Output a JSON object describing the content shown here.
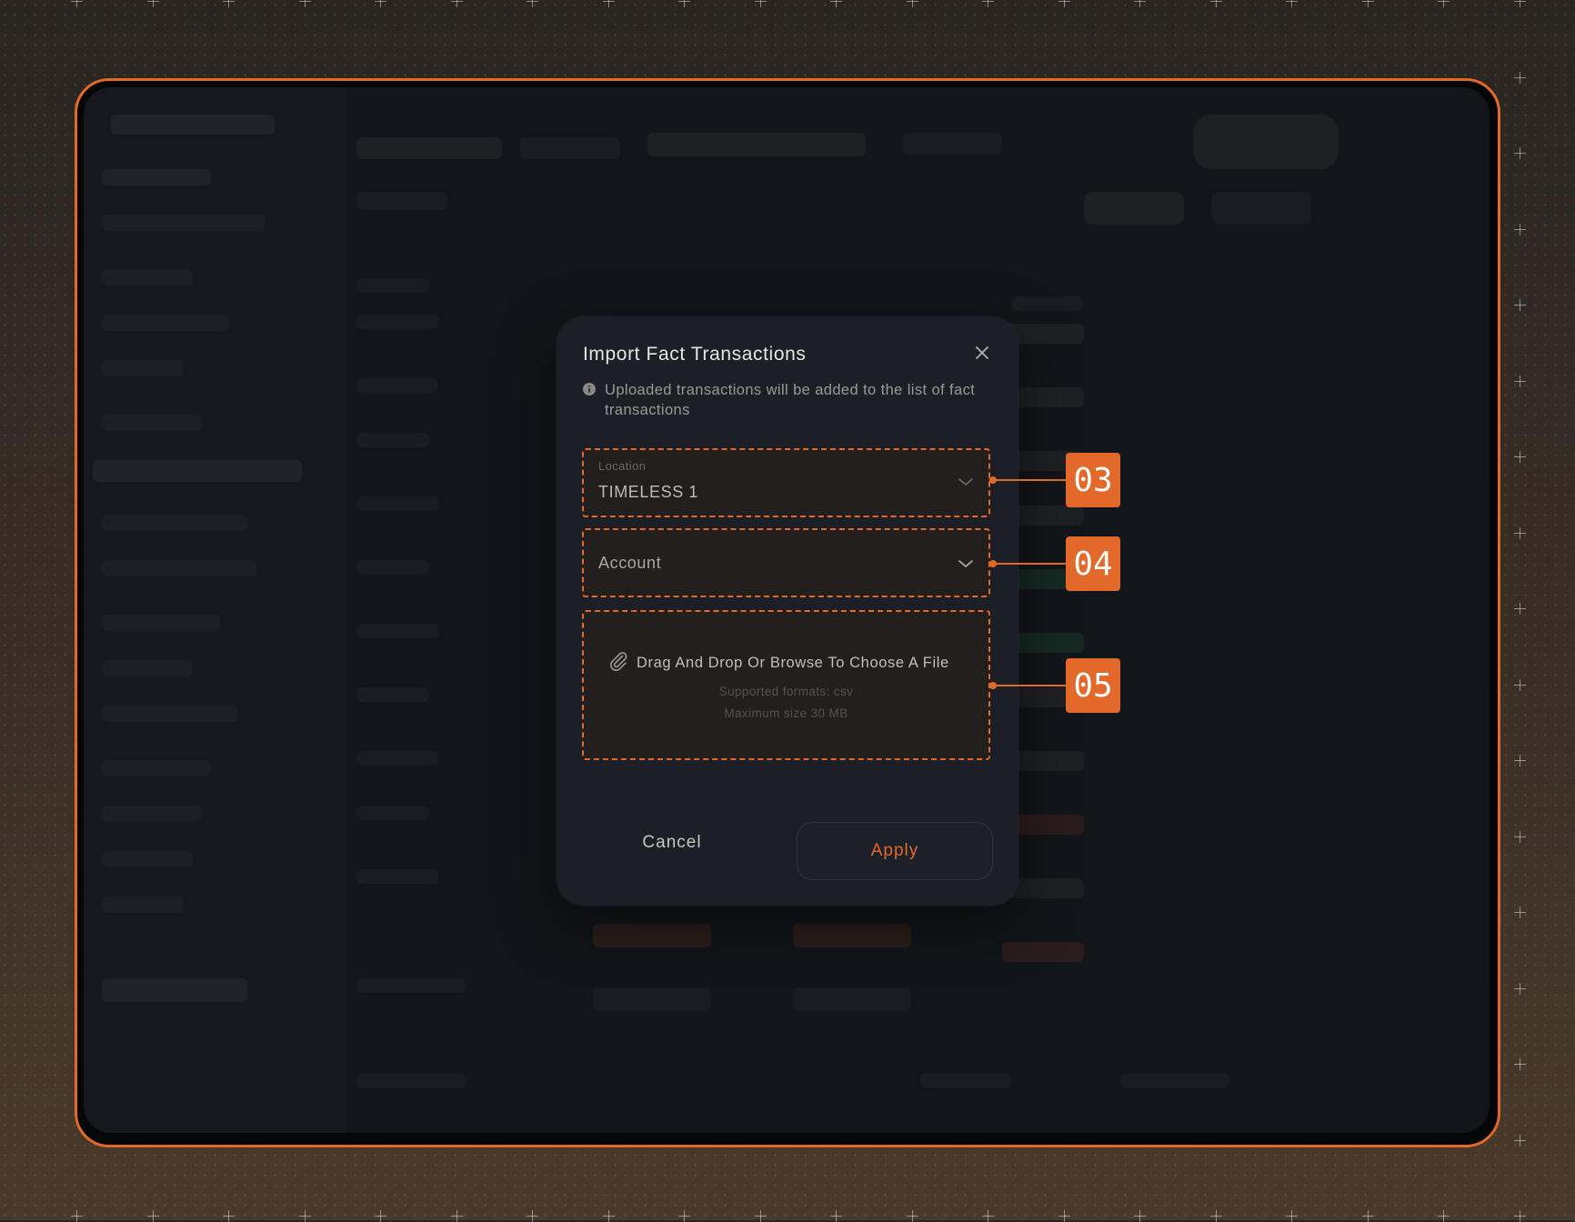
{
  "dialog": {
    "title": "Import Fact Transactions",
    "info_text": "Uploaded transactions will be added to the list of fact transactions",
    "location": {
      "label": "Location",
      "value": "TIMELESS 1"
    },
    "account": {
      "placeholder": "Account"
    },
    "dropzone": {
      "title": "Drag And Drop Or Browse To Choose A File",
      "formats": "Supported formats: csv",
      "max_size": "Maximum size 30 MB"
    },
    "cancel_label": "Cancel",
    "apply_label": "Apply"
  },
  "callouts": [
    "03",
    "04",
    "05"
  ],
  "colors": {
    "accent": "#e2692a",
    "dialog_bg": "#1c1f25",
    "screen_bg": "#121519"
  }
}
